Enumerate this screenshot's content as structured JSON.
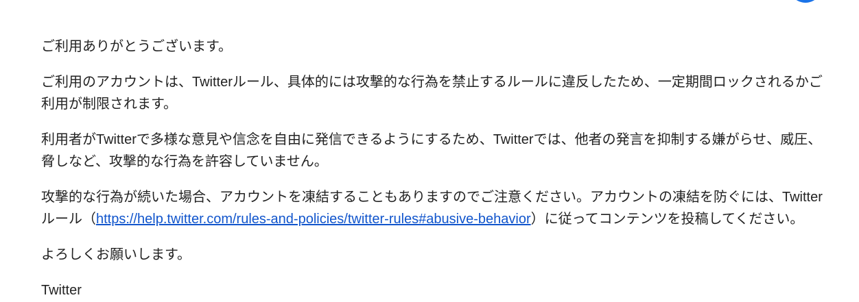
{
  "colors": {
    "text": "#222222",
    "link": "#1155cc",
    "avatar": "#1a73e8"
  },
  "email": {
    "greeting": "ご利用ありがとうございます。",
    "paragraph_1": {
      "lines": [
        "ご利用のアカウントは、Twitterルール、具体的には攻撃的な行為を禁止するルールに違反したため、一定期間ロックされるかご",
        "利用が制限されます。"
      ]
    },
    "paragraph_2": {
      "lines": [
        "利用者がTwitterで多様な意見や信念を自由に発信できるようにするため、Twitterでは、他者の発言を抑制する嫌がらせ、威圧、",
        "脅しなど、攻撃的な行為を許容していません。"
      ]
    },
    "paragraph_3": {
      "line_1": "攻撃的な行為が続いた場合、アカウントを凍結することもありますのでご注意ください。アカウントの凍結を防ぐには、Twitter",
      "line_2_prefix": "ルール（",
      "link_text": "https://help.twitter.com/rules-and-policies/twitter-rules#abusive-behavior",
      "line_2_suffix": "）に従ってコンテンツを投稿してください。"
    },
    "closing": "よろしくお願いします。",
    "signature": "Twitter"
  }
}
